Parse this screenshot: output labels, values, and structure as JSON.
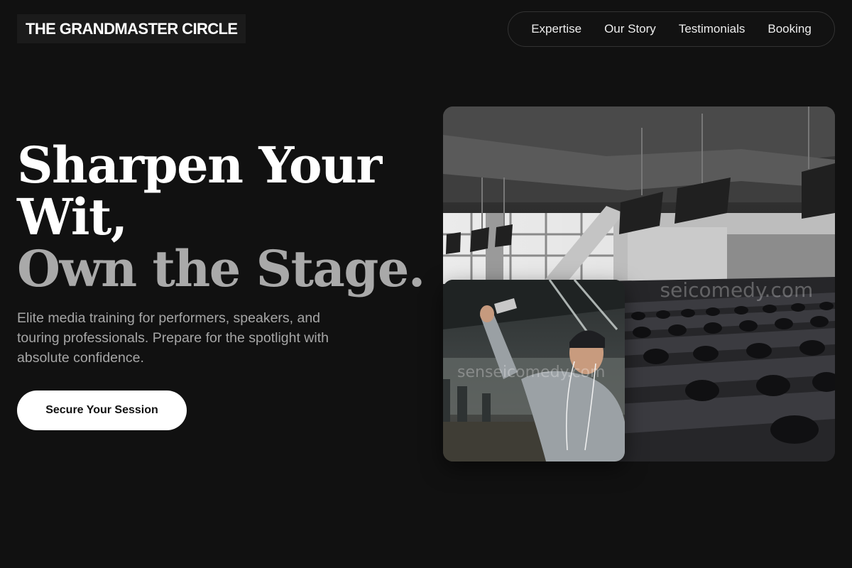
{
  "header": {
    "logo": "THE GRANDMASTER CIRCLE",
    "nav": [
      "Expertise",
      "Our Story",
      "Testimonials",
      "Booking"
    ]
  },
  "hero": {
    "title_line1": "Sharpen Your",
    "title_line2": "Wit,",
    "title_line3": "Own the Stage.",
    "subtitle": "Elite media training for performers, speakers, and touring professionals. Prepare for the spotlight with absolute confidence.",
    "cta_label": "Secure Your Session"
  },
  "images": {
    "watermark_small": "senseicomedy.com",
    "watermark_large": "senseicomedy.com"
  },
  "colors": {
    "background": "#111111",
    "accent_text": "#a9a9a9",
    "button_bg": "#ffffff"
  }
}
